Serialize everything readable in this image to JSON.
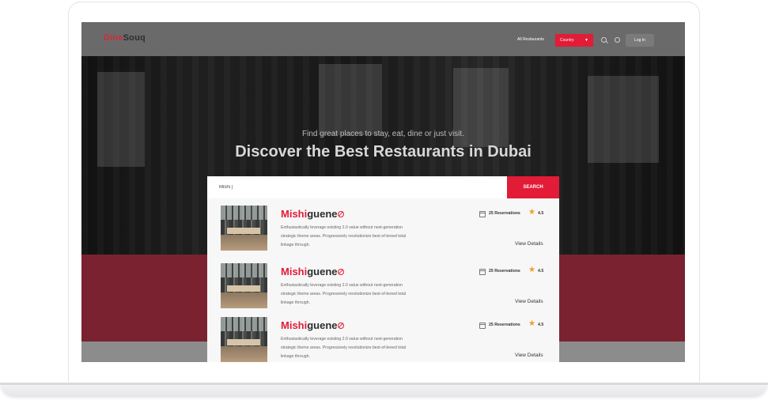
{
  "brand": {
    "logo_part1": "Dine",
    "logo_part2": "Souq"
  },
  "nav": {
    "all_restaurants": "All Restaurants",
    "country_label": "Country",
    "login_label": "Log In"
  },
  "hero": {
    "tagline": "Find great places to stay, eat, dine or just visit.",
    "title": "Discover the Best Restaurants in Dubai"
  },
  "search": {
    "query": "Mishi |",
    "button_label": "SEARCH"
  },
  "results": [
    {
      "name_match": "Mishi",
      "name_rest": "guene",
      "description": "Enthusiastically leverage existing 2.0 value without next-generation strategic theme areas. Progressively revolutionize best-of-breed total linkage through.",
      "reservations": "25 Reservations",
      "rating": "4.5",
      "view_label": "View Details"
    },
    {
      "name_match": "Mishi",
      "name_rest": "guene",
      "description": "Enthusiastically leverage existing 2.0 value without next-generation strategic theme areas. Progressively revolutionize best-of-breed total linkage through.",
      "reservations": "25 Reservations",
      "rating": "4.5",
      "view_label": "View Details"
    },
    {
      "name_match": "Mishi",
      "name_rest": "guene",
      "description": "Enthusiastically leverage existing 2.0 value without next-generation strategic theme areas. Progressively revolutionize best-of-breed total linkage through.",
      "reservations": "25 Reservations",
      "rating": "4.5",
      "view_label": "View Details"
    }
  ],
  "icons": {
    "search": "search-icon",
    "power": "power-icon",
    "caret": "chevron-down-icon",
    "no_access": "no-entry-icon",
    "calendar": "calendar-icon",
    "star": "star-icon"
  },
  "colors": {
    "accent": "#e21b37",
    "band": "#7a2230",
    "navbar": "#6a6a6a"
  }
}
